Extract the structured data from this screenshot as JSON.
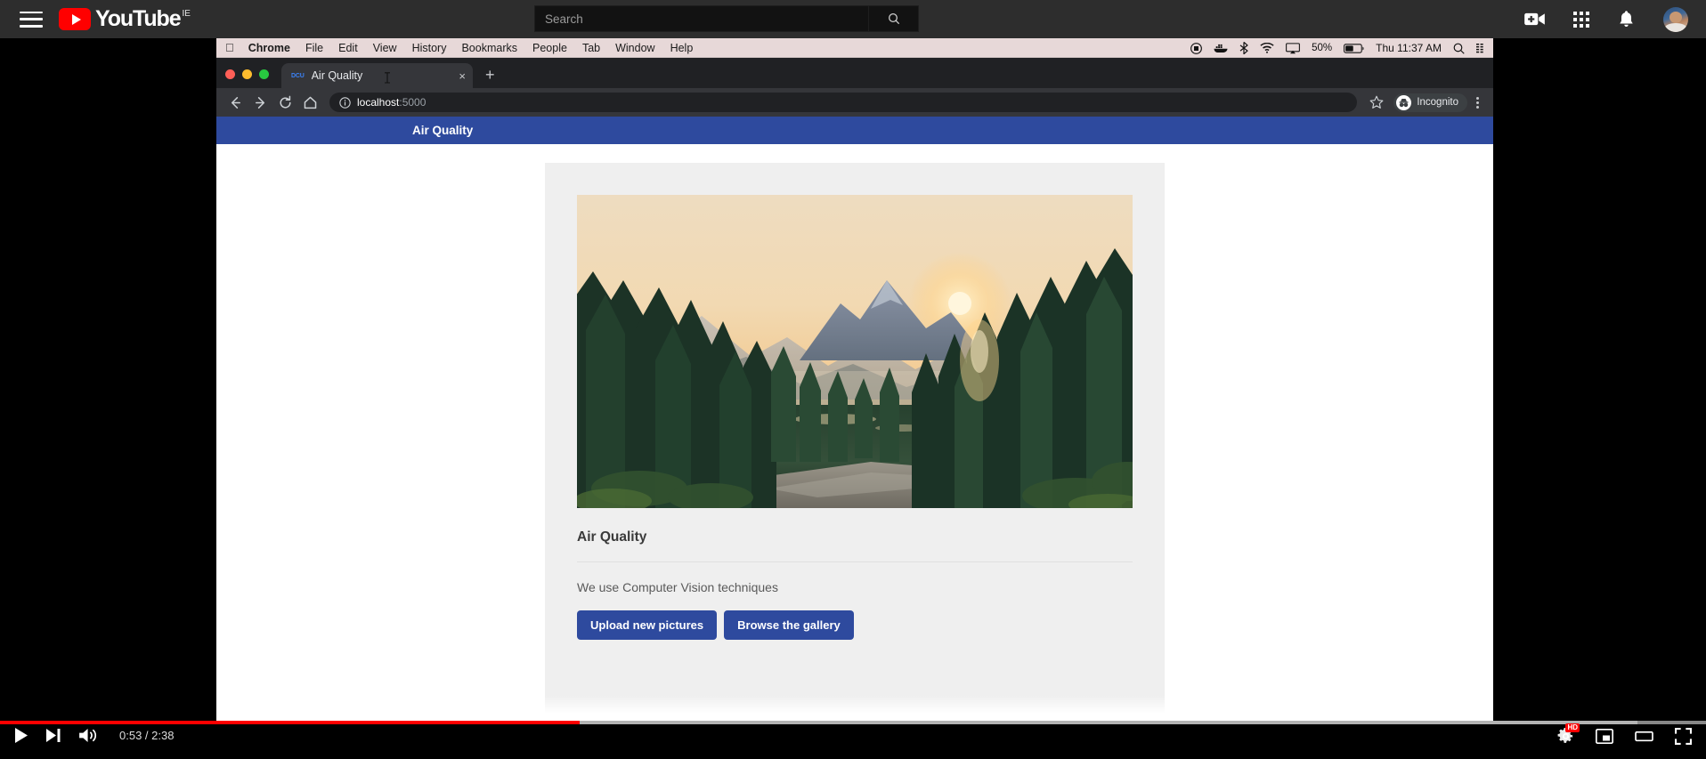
{
  "youtube": {
    "menu_icon": "hamburger-menu-icon",
    "logo_text": "YouTube",
    "logo_country": "IE",
    "search": {
      "placeholder": "Search",
      "value": "",
      "button_icon": "search-icon"
    },
    "header_icons": [
      {
        "name": "create-video-icon",
        "label": "Create"
      },
      {
        "name": "apps-grid-icon",
        "label": "YouTube apps"
      },
      {
        "name": "notifications-bell-icon",
        "label": "Notifications"
      },
      {
        "name": "avatar",
        "label": "Account"
      }
    ],
    "controls": {
      "play_label": "Play",
      "next_label": "Next",
      "volume_label": "Volume",
      "time": "0:53 / 2:38",
      "current_time": "0:53",
      "duration": "2:38",
      "progress_percent": 34,
      "loaded_percent": 96,
      "settings_label": "Settings",
      "quality_badge": "HD",
      "miniplayer_label": "Miniplayer",
      "theater_label": "Theater mode",
      "fullscreen_label": "Full screen"
    },
    "colors": {
      "brand_red": "#ff0000",
      "header_bg": "#2d2d2d"
    }
  },
  "mac": {
    "apple_logo": "",
    "menus": [
      {
        "label": "Chrome",
        "bold": true
      },
      {
        "label": "File",
        "bold": false
      },
      {
        "label": "Edit",
        "bold": false
      },
      {
        "label": "View",
        "bold": false
      },
      {
        "label": "History",
        "bold": false
      },
      {
        "label": "Bookmarks",
        "bold": false
      },
      {
        "label": "People",
        "bold": false
      },
      {
        "label": "Tab",
        "bold": false
      },
      {
        "label": "Window",
        "bold": false
      },
      {
        "label": "Help",
        "bold": false
      }
    ],
    "status_icons": [
      {
        "name": "screen-record-icon"
      },
      {
        "name": "docker-whale-icon"
      },
      {
        "name": "bluetooth-icon"
      },
      {
        "name": "wifi-icon"
      },
      {
        "name": "airplay-display-icon"
      }
    ],
    "battery_percent": "50%",
    "clock": "Thu 11:37 AM",
    "spotlight_icon": "search-icon",
    "control_center_icon": "control-center-icon"
  },
  "chrome": {
    "tab": {
      "favicon_text": "DCU",
      "title": "Air Quality",
      "close_label": "×"
    },
    "new_tab_label": "+",
    "nav": {
      "back": "back-arrow-icon",
      "forward": "forward-arrow-icon",
      "reload": "reload-icon",
      "home": "home-icon"
    },
    "omnibox": {
      "security_icon": "info-circle-icon",
      "host": "localhost",
      "port": ":5000",
      "full_url": "localhost:5000"
    },
    "bookmark_icon": "star-icon",
    "incognito": {
      "label": "Incognito",
      "icon": "incognito-spy-icon"
    },
    "menu_icon": "three-dot-menu-icon"
  },
  "page": {
    "navbar_brand": "Air Quality",
    "hero_image_alt": "Forest sunrise landscape with pine trees and mountains",
    "card_title": "Air Quality",
    "card_description": "We use Computer Vision techniques",
    "buttons": [
      {
        "label": "Upload new pictures"
      },
      {
        "label": "Browse the gallery"
      }
    ],
    "colors": {
      "primary": "#2e4a9e",
      "card_bg": "#efefef"
    }
  }
}
